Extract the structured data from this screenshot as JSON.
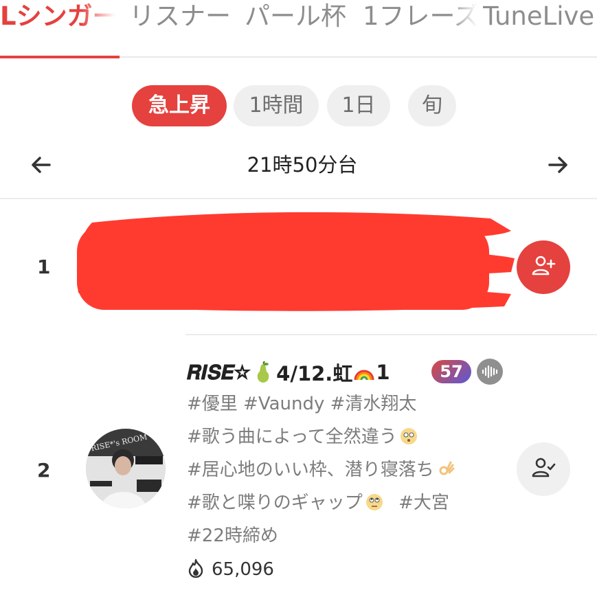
{
  "tabs": [
    {
      "label": "Lシンガー",
      "active": true
    },
    {
      "label": "リスナー",
      "active": false
    },
    {
      "label": "パール杯",
      "active": false
    },
    {
      "label": "1フレーズ",
      "active": false
    },
    {
      "label": "TuneLive",
      "active": false
    }
  ],
  "periods": [
    {
      "label": "急上昇",
      "active": true
    },
    {
      "label": "1時間",
      "active": false
    },
    {
      "label": "1日",
      "active": false
    },
    {
      "label": "旬",
      "active": false
    }
  ],
  "time_nav": {
    "label": "21時50分台",
    "prev_icon": "arrow-left-icon",
    "next_icon": "arrow-right-icon"
  },
  "ranking": [
    {
      "rank": "1",
      "redacted": true,
      "follow_state": "add-user-icon"
    },
    {
      "rank": "2",
      "title_part1": "𝑹𝑰𝑺𝑬☆",
      "title_part2": "4/12.虹",
      "title_part3": "1",
      "level": "57",
      "tags": [
        "#優里 #Vaundy #清水翔太",
        "#歌う曲によって全然違う",
        "#居心地のいい枠、潜り寝落ち",
        "#歌と喋りのギャップ",
        "#大宮",
        "#22時締め"
      ],
      "listeners": "65,096",
      "follow_state": "user-check-icon",
      "avatar_text_top": "RISE*'s ROOM"
    }
  ],
  "colors": {
    "accent": "#e5413e",
    "pill_bg": "#efefef",
    "muted_text": "#7c7c7c"
  }
}
